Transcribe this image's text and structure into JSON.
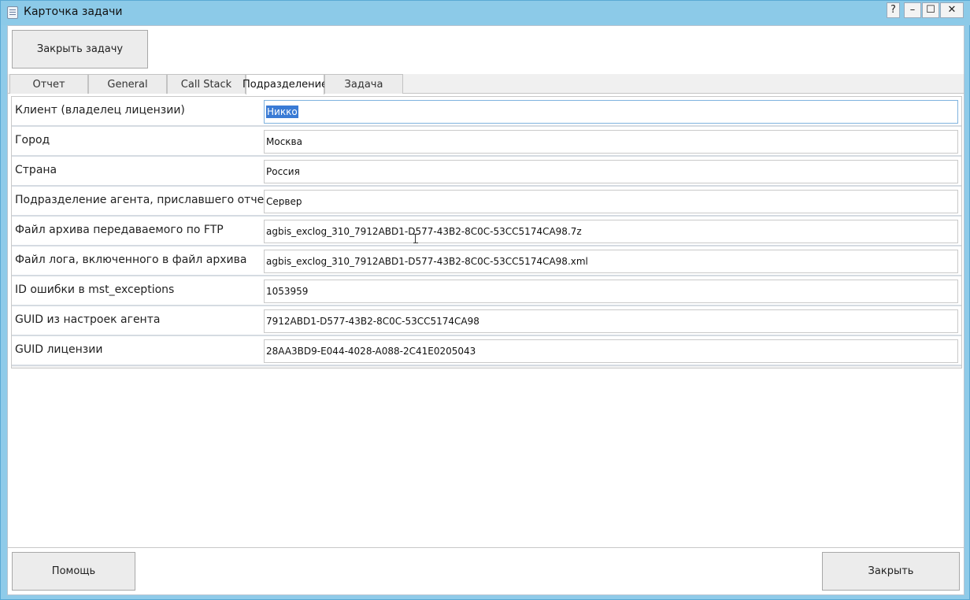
{
  "window": {
    "title": "Карточка задачи",
    "controls": {
      "help": "?",
      "minimize": "–",
      "maximize": "☐",
      "close": "✕"
    }
  },
  "toolbar": {
    "close_task_label": "Закрыть задачу"
  },
  "tabs": [
    {
      "label": "Отчет",
      "active": false
    },
    {
      "label": "General",
      "active": false
    },
    {
      "label": "Call Stack",
      "active": false
    },
    {
      "label": "Подразделение",
      "active": true
    },
    {
      "label": "Задача",
      "active": false
    }
  ],
  "fields": [
    {
      "label": "Клиент (владелец лицензии)",
      "value": "Никко"
    },
    {
      "label": "Город",
      "value": "Москва"
    },
    {
      "label": "Страна",
      "value": "Россия"
    },
    {
      "label": "Подразделение агента, приславшего отчет",
      "value": "Сервер"
    },
    {
      "label": "Файл архива передаваемого по FTP",
      "value": "agbis_exclog_310_7912ABD1-D577-43B2-8C0C-53CC5174CA98.7z"
    },
    {
      "label": "Файл лога, включенного в файл архива",
      "value": "agbis_exclog_310_7912ABD1-D577-43B2-8C0C-53CC5174CA98.xml"
    },
    {
      "label": "ID ошибки в mst_exceptions",
      "value": "1053959"
    },
    {
      "label": "GUID из настроек агента",
      "value": "7912ABD1-D577-43B2-8C0C-53CC5174CA98"
    },
    {
      "label": "GUID лицензии",
      "value": "28AA3BD9-E044-4028-A088-2C41E0205043"
    }
  ],
  "footer": {
    "help_label": "Помощь",
    "close_label": "Закрыть"
  }
}
